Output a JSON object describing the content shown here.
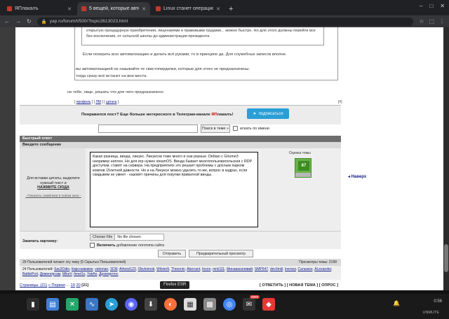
{
  "browser": {
    "tabs": [
      {
        "label": "ЯПлакалъ",
        "active": false
      },
      {
        "label": "5 вещей, которые автор",
        "active": true
      },
      {
        "label": "Linux станет операционн",
        "active": false
      }
    ],
    "new_tab": "+",
    "url": "yap.ru/forum/t/500/?topic2613023.html",
    "window_controls": [
      "–",
      "□",
      "✕"
    ]
  },
  "post": {
    "quote_inner": "открытую процедурную приобретения, лицензиями и правовыми трудами... можно быстро. Но для этого должны перейти все без исключения, от сельской школы до администрации президента.",
    "quote_line2": "Если похерить всю автоматизацию и делать всё руками, то в принципе да. Для служебных записок вполне.",
    "quote_line3": "вы автоматизацией не называйте те свистоперделки, которые для этого не предназначены.",
    "quote_line4": "тогда сразу всё встанет на вои места.",
    "reply_line": "не тебе, овце, решать что для чего предназначено",
    "links": [
      "профиль",
      "ЛМ",
      "цитата"
    ],
    "post_num": "[#]"
  },
  "telegram": {
    "text_prefix": "Понравился пост? Еще больше интересного в Телеграм-канале ",
    "text_brand": "ЯП",
    "text_suffix": "лакалъ!",
    "button": "подписаться"
  },
  "search": {
    "value": "",
    "button": "Поиск в теме »",
    "checkbox": "искать по имени"
  },
  "quick_reply": {
    "header": "Быстрый ответ",
    "sub": "Введите сообщение",
    "hint": "Для вставки цитаты, выделите нужный текст и",
    "hint_bold": "НАЖМИТЕ СЮДА",
    "smileys": "- Показать смайлики в новом окне -",
    "message": "Какая разница, винда, линукс. Линуксов тоже много и они разные. Debian с Gnome3 например неплох. Но для игр нужен steamOS. Винда бывает многопользовательская с RDP доступом, ставят на сервера. На предприятиях это решает проблемы с дохлым парком компов 15летней давности. Но и на Линуксе можно удалить то-же, вопрос в кадрах, если скидывем не умеет - назовёт причины для покупки приватной винды.",
    "rating_label": "Оценка темы",
    "rating_value": "87",
    "image_label": "Закачать картинку:",
    "file_button": "Choose File",
    "file_status": "No file chosen",
    "image_checkbox_bold": "Включить",
    "image_checkbox_rest": " добавление логотипа сайта",
    "submit": "Отправить",
    "preview": "Предварительный просмотр"
  },
  "readers": {
    "head": "29 Пользователей читают эту тему (5 Скрытых Пользователей)",
    "views": "Просмотры темы: 2158",
    "list_prefix": "24 Пользователей:",
    "users": [
      "Sav2Odin",
      "Кирсоникимо",
      "valoman",
      "3CM",
      "Atheist123",
      "Obvtoinrsk",
      "Wilster5",
      "Threonin",
      "Aberrant",
      "foxon",
      "mnk111",
      "Минавасиливий",
      "SMP647",
      "dev3mill",
      "lnersey",
      "Сальмон",
      "ALexander",
      "BattlePort",
      "Деменорсам",
      "MikeV",
      "fenel1x",
      "YakAn",
      "Дроворотос"
    ]
  },
  "pager": {
    "prefix": "Страницы: (21)",
    "first": "« Первая",
    "dots": "...",
    "p19": "19",
    "p20": "20",
    "p21": "[21]",
    "actions": "[ ОТВЕТИТЬ ] [ НОВАЯ ТЕМА ] [ ОПРОС ]",
    "side_link": "Наверх"
  },
  "tooltip": "Firefox ESR",
  "taskbar": {
    "badge": "9999",
    "clock": "0:56",
    "unmute": "UNMUTE",
    "colors": {
      "terminal": "#2d2d2d",
      "files": "#3f7fd6",
      "xfce": "#22a86a",
      "monitor": "#3a76c4",
      "telegram": "#2a9fd6",
      "discord": "#5865f2",
      "app": "#444444",
      "firefox": "#ff7139",
      "shelf": "#dddddd",
      "calc": "#888888",
      "chrome": "#4285f4",
      "anydesk": "#e53935"
    }
  }
}
